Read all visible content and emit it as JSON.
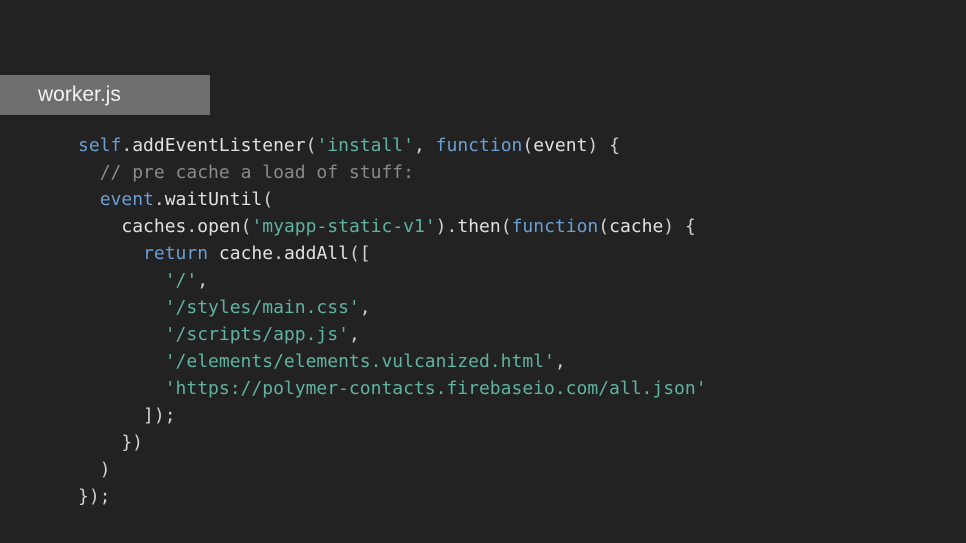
{
  "tab": {
    "title": "worker.js"
  },
  "code": {
    "tokens": [
      {
        "t": "self",
        "c": "kw"
      },
      {
        "t": ".",
        "c": "pn"
      },
      {
        "t": "addEventListener",
        "c": "fn"
      },
      {
        "t": "(",
        "c": "pn"
      },
      {
        "t": "'install'",
        "c": "str"
      },
      {
        "t": ", ",
        "c": "pn"
      },
      {
        "t": "function",
        "c": "kw"
      },
      {
        "t": "(",
        "c": "pn"
      },
      {
        "t": "event",
        "c": "id"
      },
      {
        "t": ") {",
        "c": "pn"
      },
      {
        "t": "\n",
        "c": ""
      },
      {
        "t": "  ",
        "c": "pn"
      },
      {
        "t": "// pre cache a load of stuff:",
        "c": "cmt"
      },
      {
        "t": "\n",
        "c": ""
      },
      {
        "t": "  ",
        "c": "pn"
      },
      {
        "t": "event",
        "c": "kw"
      },
      {
        "t": ".",
        "c": "pn"
      },
      {
        "t": "waitUntil",
        "c": "fn"
      },
      {
        "t": "(",
        "c": "pn"
      },
      {
        "t": "\n",
        "c": ""
      },
      {
        "t": "    ",
        "c": "pn"
      },
      {
        "t": "caches",
        "c": "id"
      },
      {
        "t": ".",
        "c": "pn"
      },
      {
        "t": "open",
        "c": "fn"
      },
      {
        "t": "(",
        "c": "pn"
      },
      {
        "t": "'myapp-static-v1'",
        "c": "str"
      },
      {
        "t": ").",
        "c": "pn"
      },
      {
        "t": "then",
        "c": "fn"
      },
      {
        "t": "(",
        "c": "pn"
      },
      {
        "t": "function",
        "c": "kw"
      },
      {
        "t": "(",
        "c": "pn"
      },
      {
        "t": "cache",
        "c": "id"
      },
      {
        "t": ") {",
        "c": "pn"
      },
      {
        "t": "\n",
        "c": ""
      },
      {
        "t": "      ",
        "c": "pn"
      },
      {
        "t": "return",
        "c": "kw"
      },
      {
        "t": " ",
        "c": "pn"
      },
      {
        "t": "cache",
        "c": "id"
      },
      {
        "t": ".",
        "c": "pn"
      },
      {
        "t": "addAll",
        "c": "fn"
      },
      {
        "t": "([",
        "c": "pn"
      },
      {
        "t": "\n",
        "c": ""
      },
      {
        "t": "        ",
        "c": "pn"
      },
      {
        "t": "'/'",
        "c": "str"
      },
      {
        "t": ",",
        "c": "pn"
      },
      {
        "t": "\n",
        "c": ""
      },
      {
        "t": "        ",
        "c": "pn"
      },
      {
        "t": "'/styles/main.css'",
        "c": "str"
      },
      {
        "t": ",",
        "c": "pn"
      },
      {
        "t": "\n",
        "c": ""
      },
      {
        "t": "        ",
        "c": "pn"
      },
      {
        "t": "'/scripts/app.js'",
        "c": "str"
      },
      {
        "t": ",",
        "c": "pn"
      },
      {
        "t": "\n",
        "c": ""
      },
      {
        "t": "        ",
        "c": "pn"
      },
      {
        "t": "'/elements/elements.vulcanized.html'",
        "c": "str"
      },
      {
        "t": ",",
        "c": "pn"
      },
      {
        "t": "\n",
        "c": ""
      },
      {
        "t": "        ",
        "c": "pn"
      },
      {
        "t": "'https://polymer-contacts.firebaseio.com/all.json'",
        "c": "str"
      },
      {
        "t": "\n",
        "c": ""
      },
      {
        "t": "      ]);",
        "c": "pn"
      },
      {
        "t": "\n",
        "c": ""
      },
      {
        "t": "    })",
        "c": "pn"
      },
      {
        "t": "\n",
        "c": ""
      },
      {
        "t": "  )",
        "c": "pn"
      },
      {
        "t": "\n",
        "c": ""
      },
      {
        "t": "});",
        "c": "pn"
      }
    ]
  }
}
